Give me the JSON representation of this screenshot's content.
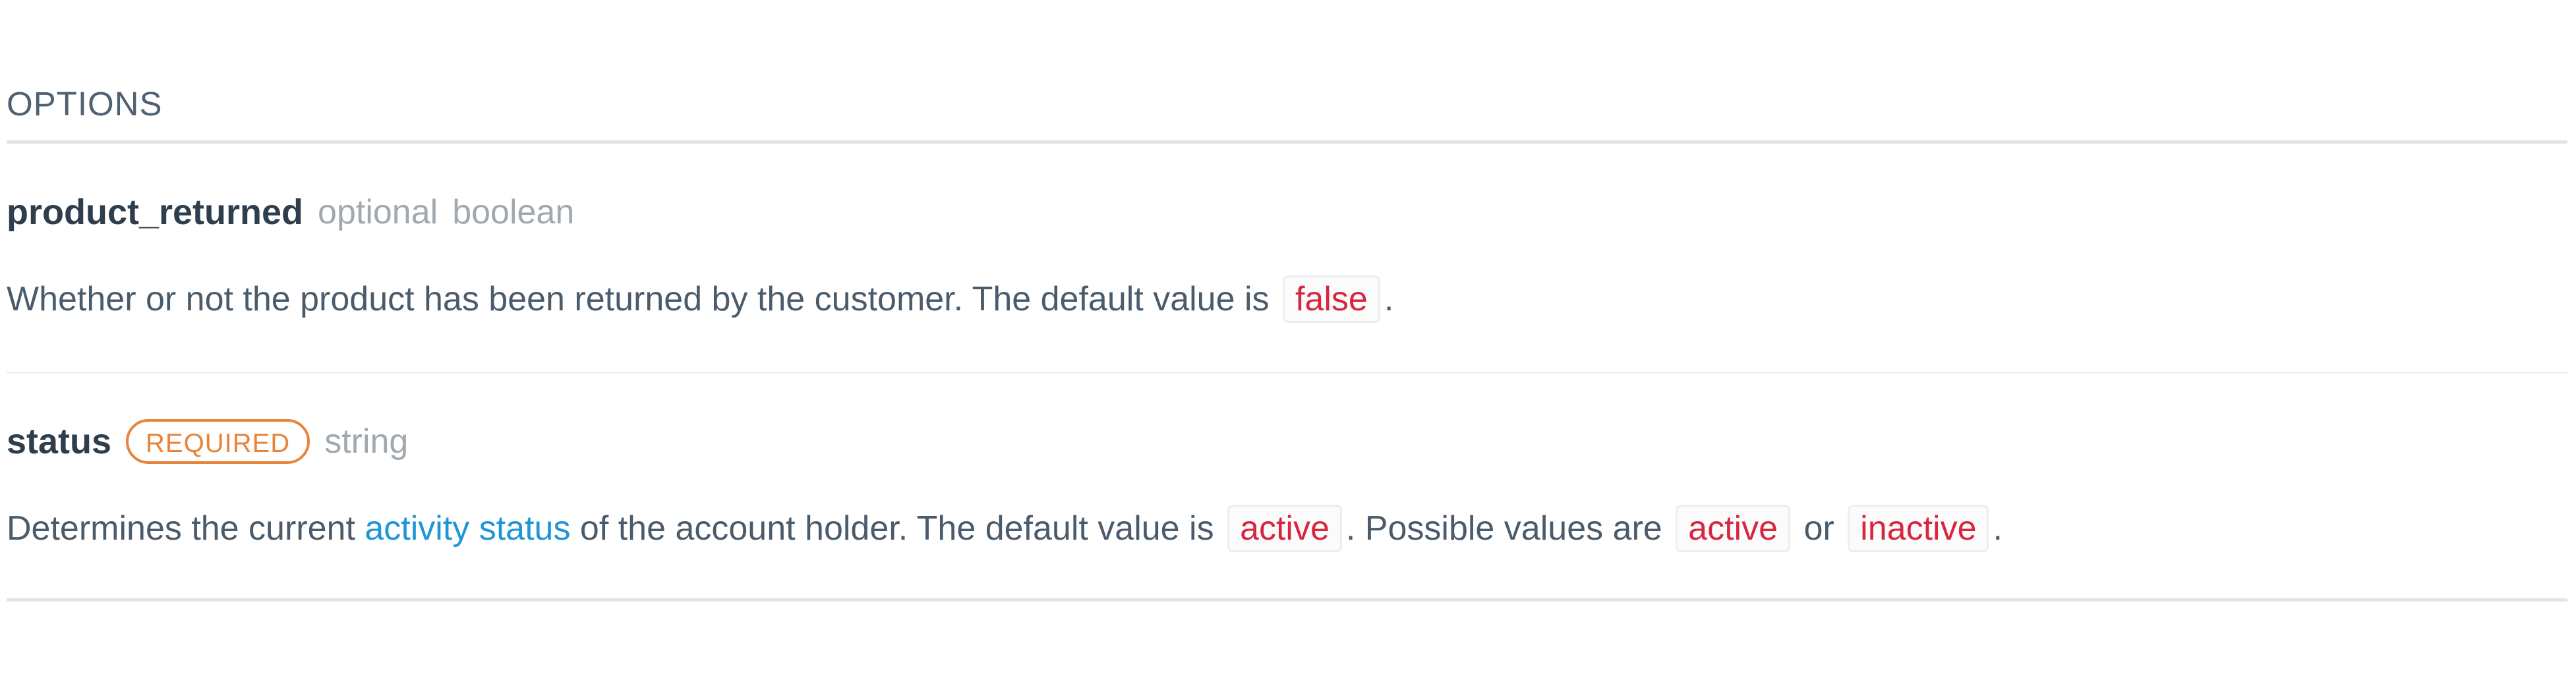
{
  "section": {
    "title": "OPTIONS"
  },
  "options": [
    {
      "name": "product_returned",
      "qualifier": "optional",
      "type": "boolean",
      "description": {
        "text_1": "Whether or not the product has been returned by the customer. The default value is",
        "default_value": "false",
        "text_2": "."
      }
    },
    {
      "name": "status",
      "badge": "REQUIRED",
      "type": "string",
      "description": {
        "text_1": "Determines the current",
        "link": "activity status",
        "text_2": "of the account holder. The default value is",
        "default_value": "active",
        "text_3": ". Possible values are",
        "value_1": "active",
        "text_4": "or",
        "value_2": "inactive",
        "text_5": "."
      }
    }
  ],
  "colors": {
    "required_badge": "#e8833a",
    "code_value": "#d7263d",
    "link": "#1f95d6"
  }
}
